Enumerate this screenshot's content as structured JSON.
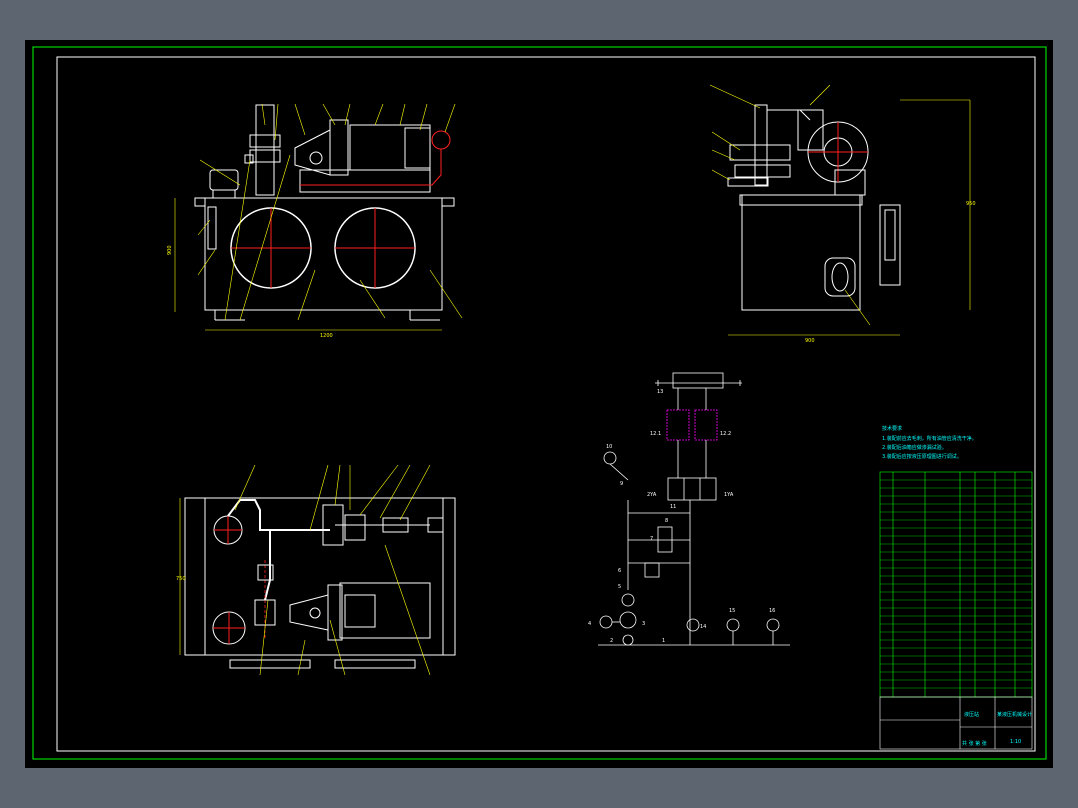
{
  "drawing": {
    "background": "#000000",
    "colors": {
      "outline": "#ffffff",
      "accent": "#ffff00",
      "center": "#ff2020",
      "frame": "#00ff00",
      "highlight": "#ff00ff",
      "viewer_bg": "#5d6670"
    },
    "front_view": {
      "dim_width": "1200",
      "dim_height": "900"
    },
    "side_view": {
      "dim_width": "900",
      "dim_height": "950"
    },
    "top_view": {
      "dim_height": "750"
    },
    "schematic": {
      "labels": [
        "13",
        "12.1",
        "12.2",
        "10",
        "9",
        "11",
        "8",
        "7",
        "6",
        "5",
        "4",
        "3",
        "2",
        "1",
        "14",
        "15",
        "16",
        "2YA",
        "1YA"
      ]
    },
    "notes": {
      "title": "技术要求",
      "lines": [
        "1.装配前应去毛刺，所有油管应清洗干净。",
        "2.装配后油箱应做渗漏试验。",
        "3.装配后应按液压原理图进行调试。"
      ]
    },
    "title_block": {
      "drawing_name": "液压站",
      "company": "某液压机械设计",
      "scale": "1:10",
      "sheet_label": "共 张 第 张"
    }
  }
}
